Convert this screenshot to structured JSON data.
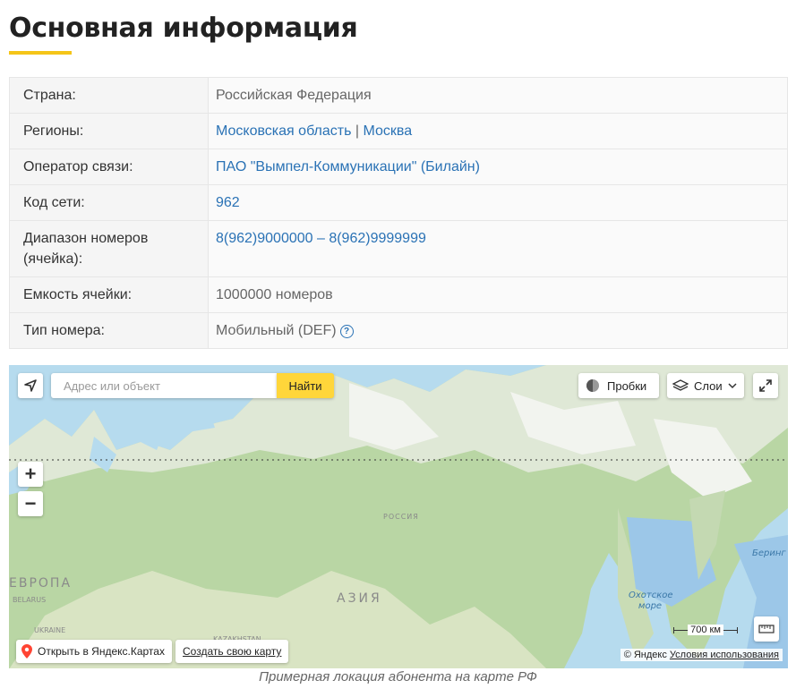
{
  "heading": "Основная информация",
  "colors": {
    "accent": "#f5c518",
    "link": "#2a72b5",
    "search_button": "#ffd63a"
  },
  "info": {
    "country_label": "Страна:",
    "country_value": "Российская Федерация",
    "regions_label": "Регионы:",
    "region_1": "Московская область",
    "region_separator": "|",
    "region_2": "Москва",
    "operator_label": "Оператор связи:",
    "operator_value": "ПАО \"Вымпел-Коммуникации\" (Билайн)",
    "code_label": "Код сети:",
    "code_value": "962",
    "range_label": "Диапазон номеров (ячейка):",
    "range_value": "8(962)9000000 – 8(962)9999999",
    "capacity_label": "Емкость ячейки:",
    "capacity_value": "1000000 номеров",
    "type_label": "Тип номера:",
    "type_value": "Мобильный (DEF)",
    "help_icon": "question-circle-icon",
    "help_glyph": "?"
  },
  "map": {
    "search_placeholder": "Адрес или объект",
    "search_button": "Найти",
    "traffic_label": "Пробки",
    "layers_label": "Слои",
    "zoom_in": "+",
    "zoom_out": "−",
    "open_link": "Открыть в Яндекс.Картах",
    "create_link": "Создать свою карту",
    "scale_label": "700 км",
    "copyright": "© Яндекс",
    "terms": "Условия использования",
    "labels": {
      "europe": "ЕВРОПА",
      "asia": "АЗИЯ",
      "russia": "РОССИЯ",
      "belarus": "BELARUS",
      "ukraine": "UKRAINE",
      "kazakhstan": "KAZAKHSTAN",
      "okhotsk_sea": "Охотское море",
      "bering": "Беринг"
    },
    "icons": [
      "geolocation-icon",
      "traffic-icon",
      "layers-icon",
      "chevron-down-icon",
      "fullscreen-icon",
      "ruler-icon",
      "map-pin-icon"
    ]
  },
  "caption": "Примерная локация абонента на карте РФ"
}
